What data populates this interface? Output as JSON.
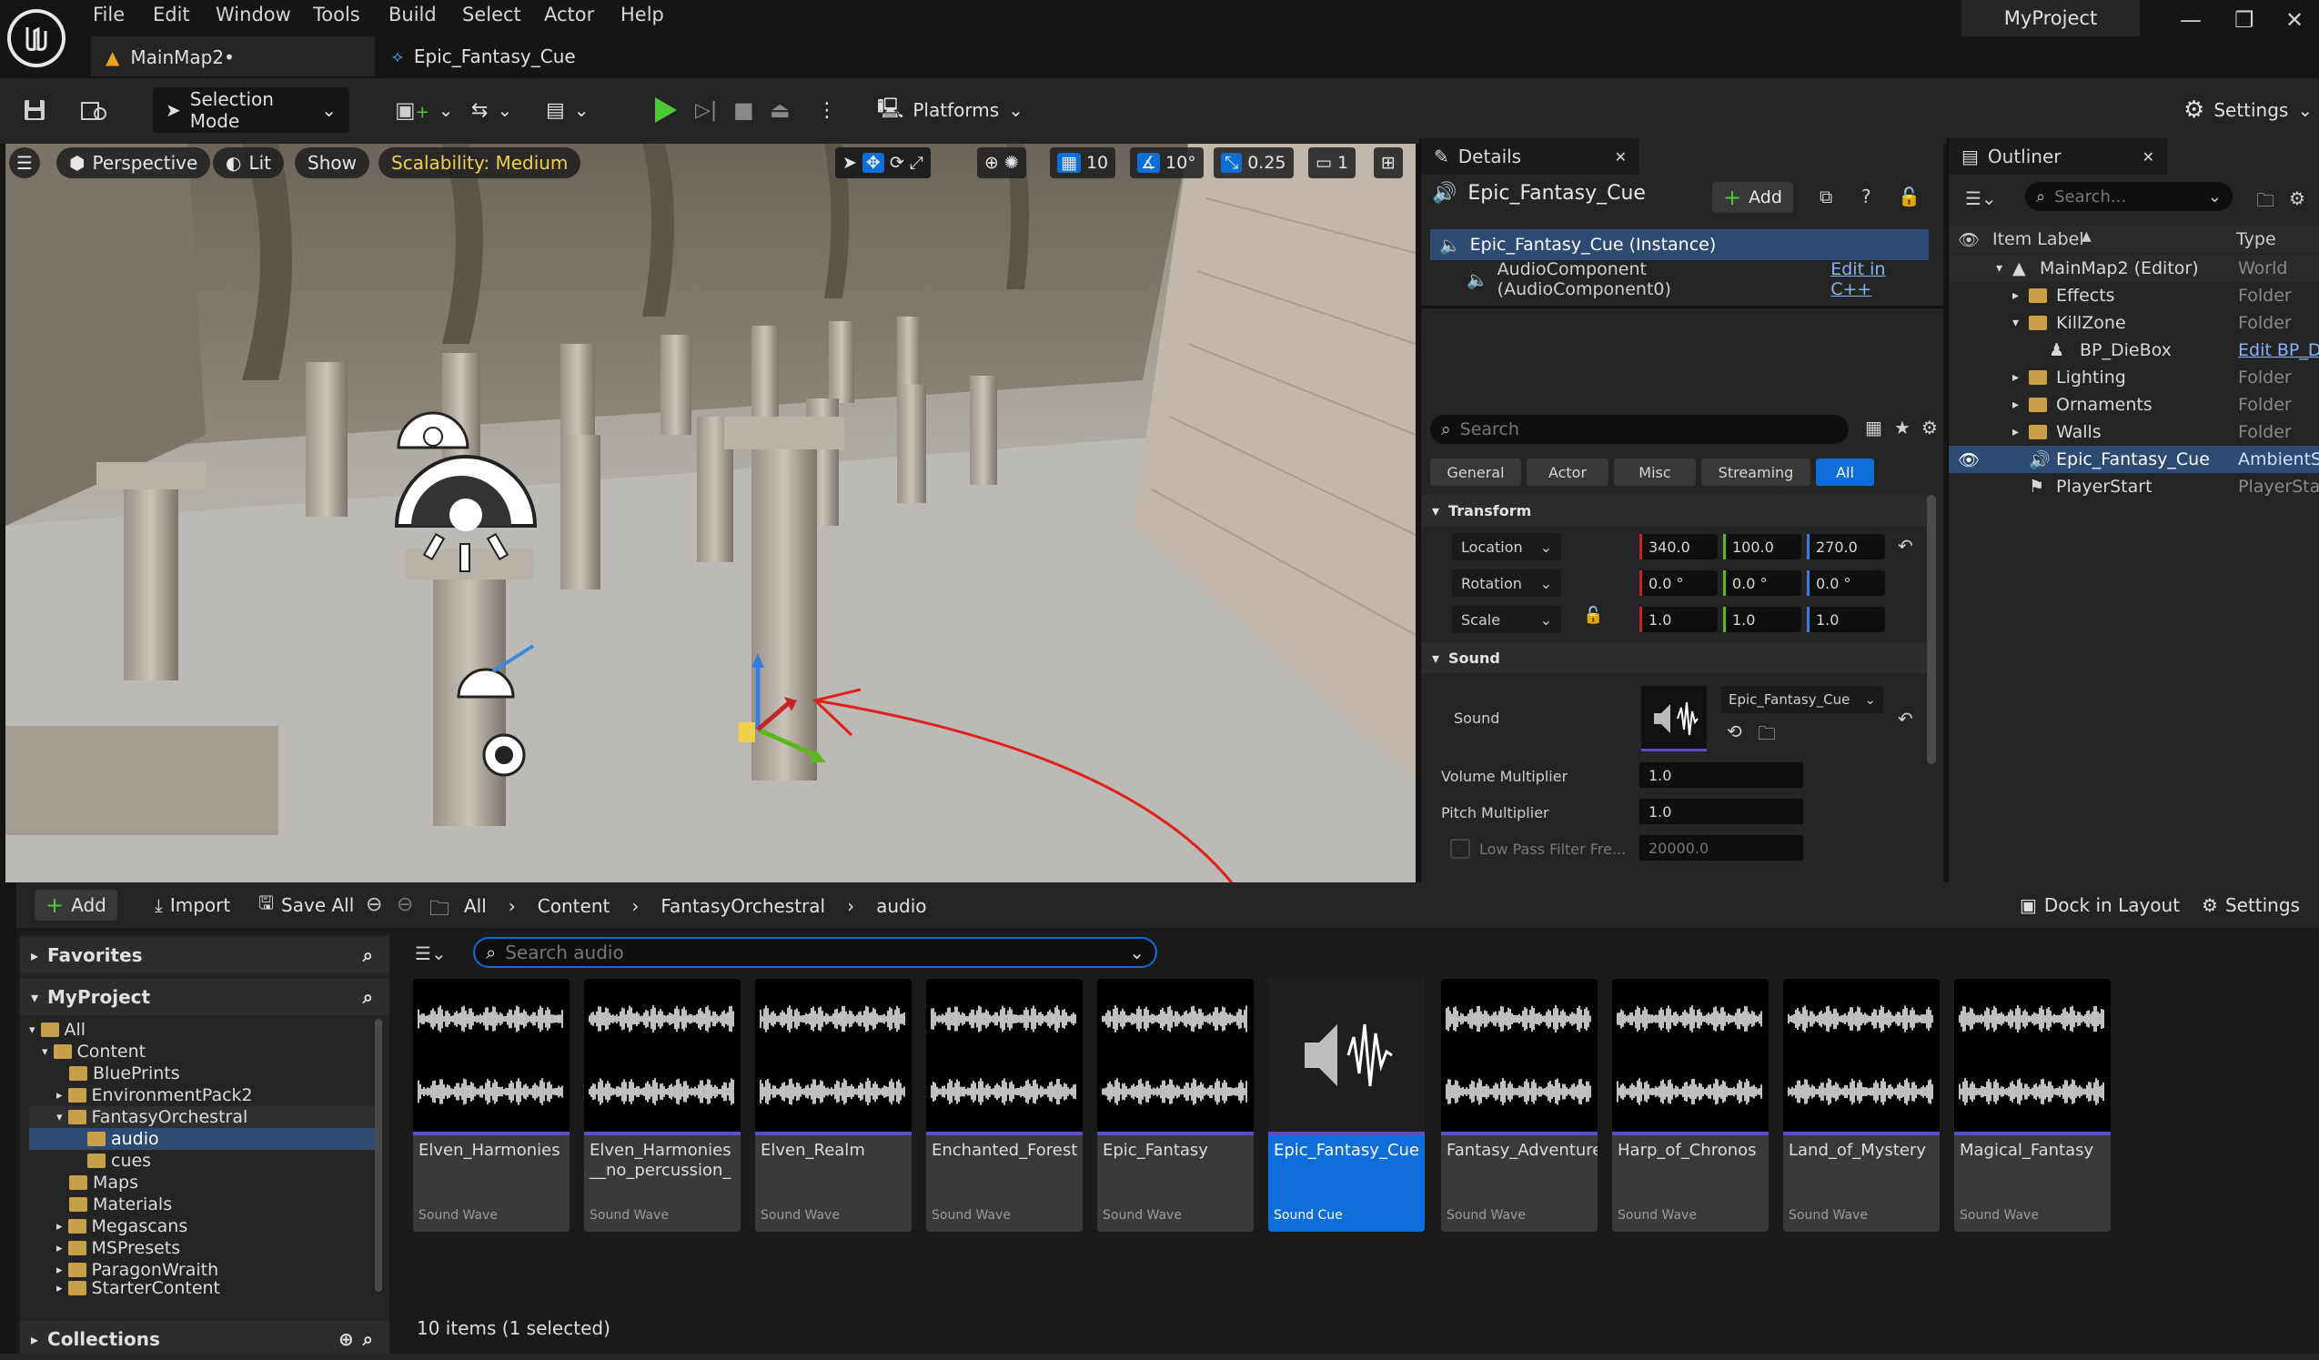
{
  "menu": [
    "File",
    "Edit",
    "Window",
    "Tools",
    "Build",
    "Select",
    "Actor",
    "Help"
  ],
  "tabs": {
    "map": "MainMap2•",
    "cue": "Epic_Fantasy_Cue"
  },
  "project_name": "MyProject",
  "toolbar": {
    "selection_mode": "Selection Mode",
    "platforms": "Platforms",
    "settings": "Settings"
  },
  "viewport": {
    "perspective": "Perspective",
    "lit": "Lit",
    "show": "Show",
    "scalability": "Scalability: Medium",
    "grid": "10",
    "angle": "10°",
    "scale": "0.25",
    "camera": "1"
  },
  "details": {
    "tab": "Details",
    "actor_name": "Epic_Fantasy_Cue",
    "add": "Add",
    "instance": "Epic_Fantasy_Cue (Instance)",
    "component": "AudioComponent (AudioComponent0)",
    "edit_cpp": "Edit in C++",
    "search_placeholder": "Search",
    "categories": [
      "General",
      "Actor",
      "Misc",
      "Streaming",
      "All"
    ],
    "transform_title": "Transform",
    "location_label": "Location",
    "rotation_label": "Rotation",
    "scale_label": "Scale",
    "location": [
      "340.0",
      "100.0",
      "270.0"
    ],
    "rotation": [
      "0.0 °",
      "0.0 °",
      "0.0 °"
    ],
    "scale": [
      "1.0",
      "1.0",
      "1.0"
    ],
    "sound_title": "Sound",
    "sound_label": "Sound",
    "sound_value": "Epic_Fantasy_Cue",
    "volume_label": "Volume Multiplier",
    "volume_value": "1.0",
    "pitch_label": "Pitch Multiplier",
    "pitch_value": "1.0",
    "lowpass_label": "Low Pass Filter Fre...",
    "lowpass_value": "20000.0"
  },
  "outliner": {
    "tab": "Outliner",
    "search_placeholder": "Search...",
    "col_label": "Item Label",
    "col_type": "Type",
    "rows": [
      {
        "label": "MainMap2 (Editor)",
        "type": "World"
      },
      {
        "label": "Effects",
        "type": "Folder"
      },
      {
        "label": "KillZone",
        "type": "Folder"
      },
      {
        "label": "BP_DieBox",
        "type": "Edit BP_D"
      },
      {
        "label": "Lighting",
        "type": "Folder"
      },
      {
        "label": "Ornaments",
        "type": "Folder"
      },
      {
        "label": "Walls",
        "type": "Folder"
      },
      {
        "label": "Epic_Fantasy_Cue",
        "type": "AmbientSo"
      },
      {
        "label": "PlayerStart",
        "type": "PlayerStar"
      }
    ]
  },
  "content_browser": {
    "add": "Add",
    "import": "Import",
    "save_all": "Save All",
    "breadcrumb": [
      "All",
      "Content",
      "FantasyOrchestral",
      "audio"
    ],
    "dock": "Dock in Layout",
    "settings": "Settings",
    "favorites": "Favorites",
    "project": "MyProject",
    "collections": "Collections",
    "search_placeholder": "Search audio",
    "tree": [
      "All",
      "Content",
      "BluePrints",
      "EnvironmentPack2",
      "FantasyOrchestral",
      "audio",
      "cues",
      "Maps",
      "Materials",
      "Megascans",
      "MSPresets",
      "ParagonWraith",
      "StarterContent"
    ],
    "assets": [
      {
        "name": "Elven_Harmonies",
        "type": "Sound Wave"
      },
      {
        "name": "Elven_Harmonies__no_percussion_",
        "type": "Sound Wave"
      },
      {
        "name": "Elven_Realm",
        "type": "Sound Wave"
      },
      {
        "name": "Enchanted_Forest",
        "type": "Sound Wave"
      },
      {
        "name": "Epic_Fantasy",
        "type": "Sound Wave"
      },
      {
        "name": "Epic_Fantasy_Cue",
        "type": "Sound Cue"
      },
      {
        "name": "Fantasy_Adventure",
        "type": "Sound Wave"
      },
      {
        "name": "Harp_of_Chronos",
        "type": "Sound Wave"
      },
      {
        "name": "Land_of_Mystery",
        "type": "Sound Wave"
      },
      {
        "name": "Magical_Fantasy",
        "type": "Sound Wave"
      }
    ],
    "status": "10 items (1 selected)"
  },
  "colors": {
    "accent": "#0d6ed9",
    "play": "#4ccb34",
    "scalability": "#f1d04a",
    "annotation": "#e0201a"
  }
}
